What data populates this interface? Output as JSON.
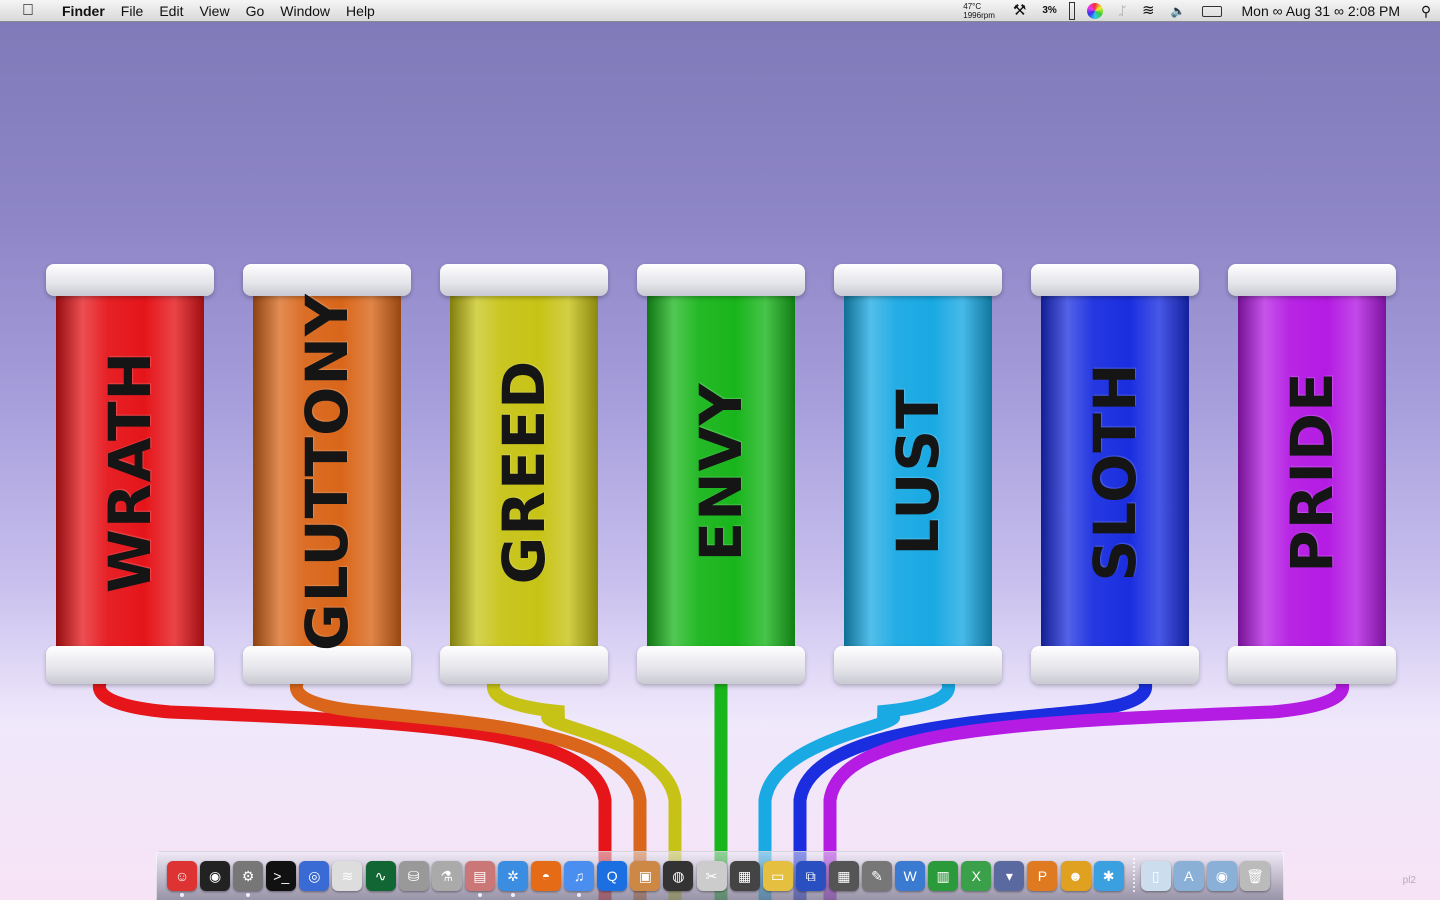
{
  "menubar": {
    "apple_icon": "apple-logo-icon",
    "app_name": "Finder",
    "menus": [
      "File",
      "Edit",
      "View",
      "Go",
      "Window",
      "Help"
    ],
    "extras": {
      "temp": "47°C",
      "fan": "1996rpm",
      "tools_icon": "tools-icon",
      "cpu": "3%",
      "clock": "Mon ∞ Aug 31 ∞ 2:08 PM"
    }
  },
  "wallpaper": {
    "canisters": [
      {
        "label": "WRATH",
        "color": "#e5151a"
      },
      {
        "label": "GLUTTONY",
        "color": "#d9661a"
      },
      {
        "label": "GREED",
        "color": "#c7c316"
      },
      {
        "label": "ENVY",
        "color": "#19b51c"
      },
      {
        "label": "LUST",
        "color": "#19a9e3"
      },
      {
        "label": "SLOTH",
        "color": "#1a2ee0"
      },
      {
        "label": "PRIDE",
        "color": "#b41be3"
      }
    ],
    "signature": "pl2"
  },
  "dock": {
    "apps": [
      {
        "name": "finder-icon",
        "color": "#d33",
        "glyph": "☺",
        "running": true
      },
      {
        "name": "dashboard-icon",
        "color": "#222",
        "glyph": "◉",
        "running": false
      },
      {
        "name": "system-preferences-icon",
        "color": "#777",
        "glyph": "⚙",
        "running": true
      },
      {
        "name": "terminal-icon",
        "color": "#111",
        "glyph": ">_",
        "running": false
      },
      {
        "name": "spaces-icon",
        "color": "#3a6ad3",
        "glyph": "◎",
        "running": false
      },
      {
        "name": "airport-icon",
        "color": "#ddd",
        "glyph": "≋",
        "running": false
      },
      {
        "name": "activity-monitor-icon",
        "color": "#163",
        "glyph": "∿",
        "running": false
      },
      {
        "name": "disk-utility-icon",
        "color": "#999",
        "glyph": "⛁",
        "running": false
      },
      {
        "name": "script-editor-icon",
        "color": "#aaa",
        "glyph": "⚗",
        "running": false
      },
      {
        "name": "preview-icon",
        "color": "#c77",
        "glyph": "▤",
        "running": true
      },
      {
        "name": "safari-icon",
        "color": "#3a8de0",
        "glyph": "✲",
        "running": true
      },
      {
        "name": "firefox-icon",
        "color": "#e56b17",
        "glyph": "◓",
        "running": false
      },
      {
        "name": "itunes-icon",
        "color": "#4a8ef0",
        "glyph": "♫",
        "running": true
      },
      {
        "name": "quicktime-icon",
        "color": "#1b6fe0",
        "glyph": "Q",
        "running": false
      },
      {
        "name": "iphoto-icon",
        "color": "#c84",
        "glyph": "▣",
        "running": false
      },
      {
        "name": "aperture-icon",
        "color": "#333",
        "glyph": "◍",
        "running": false
      },
      {
        "name": "imovie-icon",
        "color": "#ccc",
        "glyph": "✂",
        "running": false
      },
      {
        "name": "dvd-player-icon",
        "color": "#444",
        "glyph": "▦",
        "running": false
      },
      {
        "name": "sandwich-icon",
        "color": "#e5c040",
        "glyph": "▭",
        "running": false
      },
      {
        "name": "remote-desktop-icon",
        "color": "#2a4fc0",
        "glyph": "⧉",
        "running": false
      },
      {
        "name": "expose-icon",
        "color": "#555",
        "glyph": "▦",
        "running": false
      },
      {
        "name": "pen-icon",
        "color": "#777",
        "glyph": "✎",
        "running": false
      },
      {
        "name": "word-icon",
        "color": "#3a7ad0",
        "glyph": "W",
        "running": false
      },
      {
        "name": "numbers-icon",
        "color": "#2a9a3a",
        "glyph": "▥",
        "running": false
      },
      {
        "name": "excel-icon",
        "color": "#3aa04a",
        "glyph": "X",
        "running": false
      },
      {
        "name": "keynote-icon",
        "color": "#5a6aa0",
        "glyph": "▾",
        "running": false
      },
      {
        "name": "powerpoint-icon",
        "color": "#e07a20",
        "glyph": "P",
        "running": false
      },
      {
        "name": "alien-icon",
        "color": "#e0a020",
        "glyph": "☻",
        "running": false
      },
      {
        "name": "xcode-icon",
        "color": "#3aa0e0",
        "glyph": "✱",
        "running": false
      }
    ],
    "stacks": [
      {
        "name": "document-stack-icon",
        "color": "#cde",
        "glyph": "▯"
      },
      {
        "name": "applications-folder-icon",
        "color": "#8ab0d8",
        "glyph": "A"
      },
      {
        "name": "downloads-folder-icon",
        "color": "#8ab0d8",
        "glyph": "◉"
      },
      {
        "name": "trash-icon",
        "color": "#bbb",
        "glyph": "🗑"
      }
    ]
  }
}
